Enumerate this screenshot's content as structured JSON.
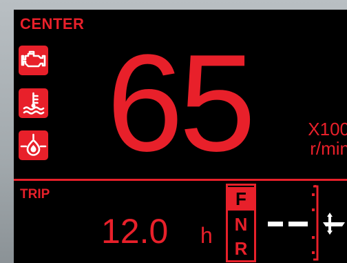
{
  "display": {
    "station_label": "CENTER",
    "warning_icons": [
      "engine-check-icon",
      "coolant-temperature-icon",
      "oil-pressure-icon"
    ],
    "rpm": {
      "value": "65",
      "multiplier": "X100",
      "unit": "r/min"
    },
    "trip": {
      "label": "TRIP",
      "value": "12.0",
      "unit": "h"
    },
    "gear": {
      "options": [
        "F",
        "N",
        "R"
      ],
      "selected": "F"
    },
    "trim_icon": "trim-gauge-icon",
    "colors": {
      "accent": "#e8202a",
      "background": "#000000",
      "bezel": "#a2a9ad"
    }
  }
}
